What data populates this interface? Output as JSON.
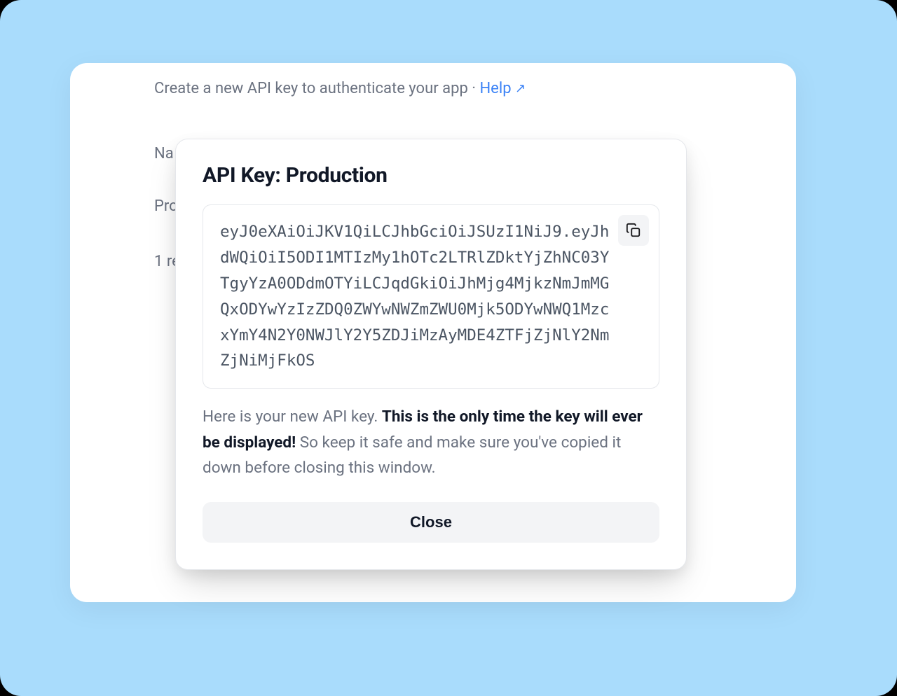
{
  "page": {
    "subtitle_pre": "Create a new API key to authenticate your app · ",
    "help_label": "Help",
    "bg_label_name": "Na",
    "bg_label_pro": "Pro",
    "bg_label_results": "1 re"
  },
  "modal": {
    "title": "API Key: Production",
    "key_value": "eyJ0eXAiOiJKV1QiLCJhbGciOiJSUzI1NiJ9.eyJhdWQiOiI5ODI1MTIzMy1hOTc2LTRlZDktYjZhNC03YTgyYzA0ODdmOTYiLCJqdGkiOiJhMjg4MjkzNmJmMGQxODYwYzIzZDQ0ZWYwNWZmZWU0Mjk5ODYwNWQ1MzcxYmY4N2Y0NWJlY2Y5ZDJiMzAyMDE4ZTFjZjNlY2NmZjNiMjFkOS",
    "warning_pre": "Here is your new API key. ",
    "warning_bold": "This is the only time the key will ever be displayed!",
    "warning_post": " So keep it safe and make sure you've copied it down before closing this window.",
    "close_label": "Close"
  }
}
